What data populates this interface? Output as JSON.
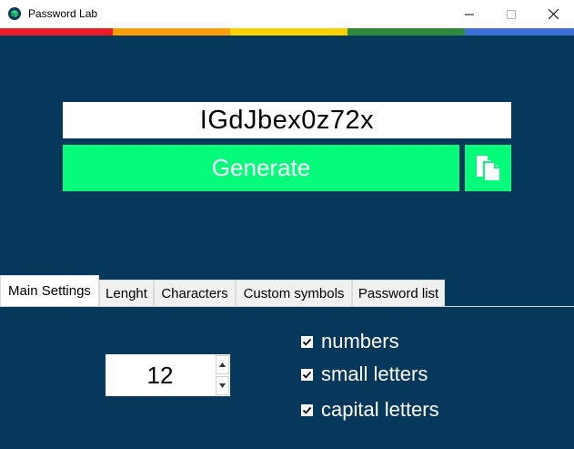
{
  "window": {
    "title": "Password Lab",
    "icon": "app-logo-icon",
    "controls": [
      "minimize-icon",
      "maximize-icon",
      "close-icon"
    ]
  },
  "stripe_colors": [
    "#ee1c24",
    "#fb9d0b",
    "#fbd100",
    "#2d8a3a",
    "#3d6fd6"
  ],
  "main": {
    "password": "IGdJbex0z72x",
    "generate_label": "Generate",
    "copy_icon": "copy-icon"
  },
  "tabs": [
    {
      "label": "Main Settings",
      "active": true
    },
    {
      "label": "Lenght",
      "active": false
    },
    {
      "label": "Characters",
      "active": false
    },
    {
      "label": "Custom symbols",
      "active": false
    },
    {
      "label": "Password list",
      "active": false
    }
  ],
  "settings": {
    "length": "12",
    "options": [
      {
        "label": "numbers",
        "checked": true
      },
      {
        "label": "small letters",
        "checked": true
      },
      {
        "label": "capital letters",
        "checked": true
      }
    ]
  },
  "colors": {
    "background": "#06385c",
    "accent": "#05fb7a"
  }
}
